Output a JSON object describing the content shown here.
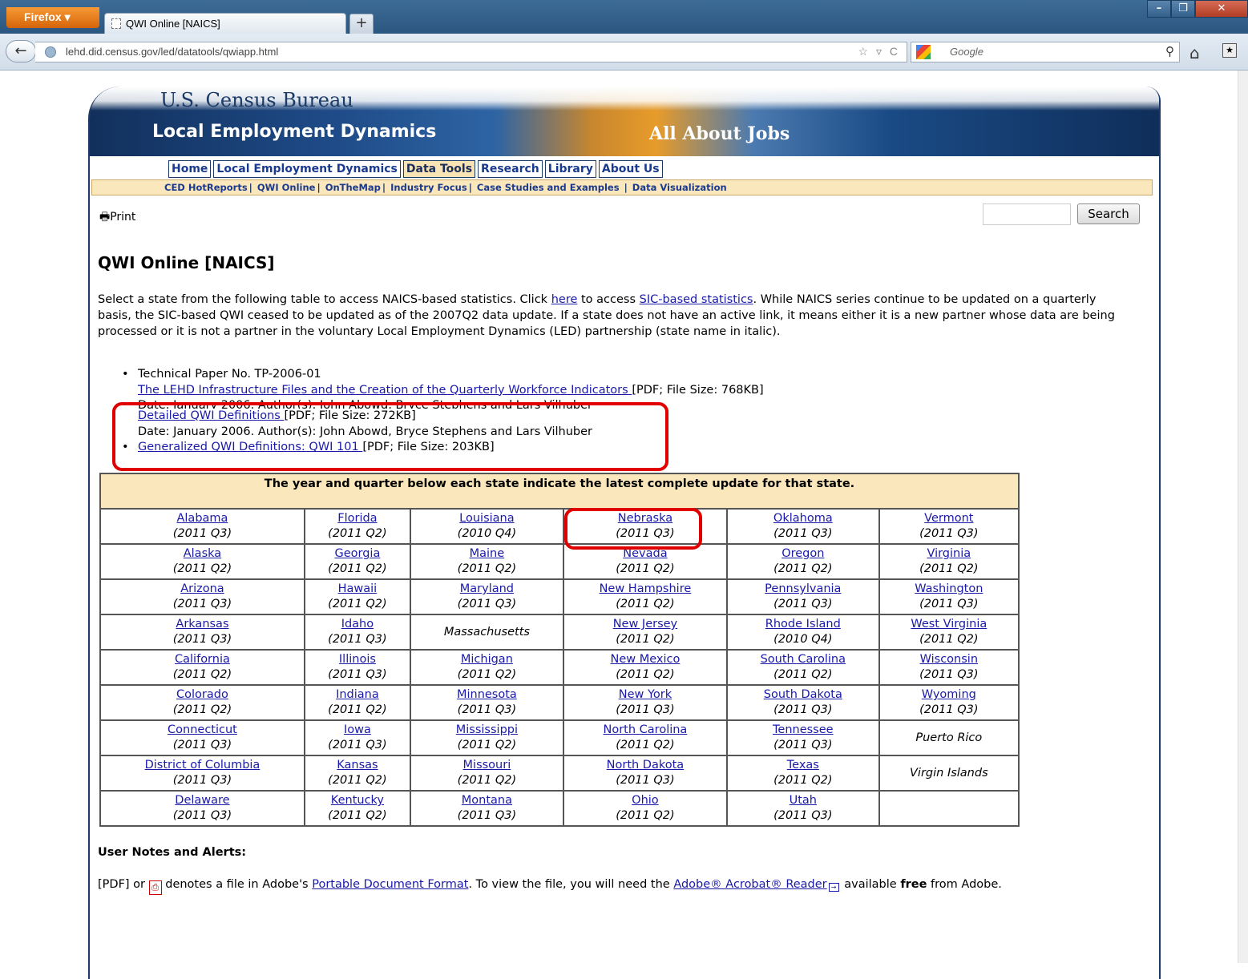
{
  "browser": {
    "menu_label": "Firefox ▾",
    "tab_title": "QWI Online [NAICS]",
    "new_tab": "+",
    "url": "lehd.did.census.gov/led/datatools/qwiapp.html",
    "search_engine_placeholder": "Google"
  },
  "banner": {
    "agency": "U.S. Census Bureau",
    "program": "Local Employment Dynamics",
    "tagline": "All About Jobs"
  },
  "nav": {
    "main": [
      "Home",
      "Local Employment Dynamics",
      "Data Tools",
      "Research",
      "Library",
      "About Us"
    ],
    "active": "Data Tools",
    "sub": [
      "CED HotReports",
      "QWI Online",
      "OnTheMap",
      "Industry Focus",
      "Case Studies and Examples",
      "Data Visualization"
    ]
  },
  "toolbar": {
    "print_label": "Print",
    "search_button": "Search"
  },
  "page": {
    "title": "QWI Online [NAICS]",
    "intro_1": "Select a state from the following table to access NAICS-based statistics. Click ",
    "intro_link_here": "here",
    "intro_2": " to access ",
    "intro_link_sic": "SIC-based statistics",
    "intro_3": ". While NAICS series continue to be updated on a quarterly basis, the SIC-based QWI ceased to be updated as of the 2007Q2 data update. If a state does not have an active link, it means either it is a new partner whose data are being processed or it is not a partner in the voluntary Local Employment Dynamics (LED) partnership (state name in italic)."
  },
  "docs": {
    "paper_no": "Technical Paper No. TP-2006-01",
    "paper_title": "The LEHD Infrastructure Files and the Creation of the Quarterly Workforce Indicators ",
    "paper_meta": "[PDF; File Size: 768KB]",
    "paper_date": "Date: January 2006. Author(s): John Abowd, Bryce Stephens and Lars Vilhuber",
    "detailed_title": "Detailed QWI Definitions ",
    "detailed_meta": "[PDF; File Size: 272KB]",
    "detailed_date": "Date: January 2006. Author(s): John Abowd, Bryce Stephens and Lars Vilhuber",
    "generalized_title": "Generalized QWI Definitions: QWI 101 ",
    "generalized_meta": "[PDF; File Size: 203KB]"
  },
  "table": {
    "header": "The year and quarter below each state indicate the latest complete update for that state.",
    "rows": [
      [
        [
          "Alabama",
          "(2011 Q3)"
        ],
        [
          "Florida",
          "(2011 Q2)"
        ],
        [
          "Louisiana",
          "(2010 Q4)"
        ],
        [
          "Nebraska",
          "(2011 Q3)"
        ],
        [
          "Oklahoma",
          "(2011 Q3)"
        ],
        [
          "Vermont",
          "(2011 Q3)"
        ]
      ],
      [
        [
          "Alaska",
          "(2011 Q2)"
        ],
        [
          "Georgia",
          "(2011 Q2)"
        ],
        [
          "Maine",
          "(2011 Q2)"
        ],
        [
          "Nevada",
          "(2011 Q2)"
        ],
        [
          "Oregon",
          "(2011 Q2)"
        ],
        [
          "Virginia",
          "(2011 Q2)"
        ]
      ],
      [
        [
          "Arizona",
          "(2011 Q3)"
        ],
        [
          "Hawaii",
          "(2011 Q2)"
        ],
        [
          "Maryland",
          "(2011 Q3)"
        ],
        [
          "New Hampshire",
          "(2011 Q2)"
        ],
        [
          "Pennsylvania",
          "(2011 Q3)"
        ],
        [
          "Washington",
          "(2011 Q3)"
        ]
      ],
      [
        [
          "Arkansas",
          "(2011 Q3)"
        ],
        [
          "Idaho",
          "(2011 Q3)"
        ],
        [
          "Massachusetts",
          ""
        ],
        [
          "New Jersey",
          "(2011 Q2)"
        ],
        [
          "Rhode Island",
          "(2010 Q4)"
        ],
        [
          "West Virginia",
          "(2011 Q2)"
        ]
      ],
      [
        [
          "California",
          "(2011 Q2)"
        ],
        [
          "Illinois",
          "(2011 Q3)"
        ],
        [
          "Michigan",
          "(2011 Q2)"
        ],
        [
          "New Mexico",
          "(2011 Q2)"
        ],
        [
          "South Carolina",
          "(2011 Q2)"
        ],
        [
          "Wisconsin",
          "(2011 Q3)"
        ]
      ],
      [
        [
          "Colorado",
          "(2011 Q2)"
        ],
        [
          "Indiana",
          "(2011 Q2)"
        ],
        [
          "Minnesota",
          "(2011 Q3)"
        ],
        [
          "New York",
          "(2011 Q3)"
        ],
        [
          "South Dakota",
          "(2011 Q3)"
        ],
        [
          "Wyoming",
          "(2011 Q3)"
        ]
      ],
      [
        [
          "Connecticut",
          "(2011 Q3)"
        ],
        [
          "Iowa",
          "(2011 Q3)"
        ],
        [
          "Mississippi",
          "(2011 Q2)"
        ],
        [
          "North Carolina",
          "(2011 Q2)"
        ],
        [
          "Tennessee",
          "(2011 Q3)"
        ],
        [
          "Puerto Rico",
          ""
        ]
      ],
      [
        [
          "District of Columbia",
          "(2011 Q3)"
        ],
        [
          "Kansas",
          "(2011 Q2)"
        ],
        [
          "Missouri",
          "(2011 Q2)"
        ],
        [
          "North Dakota",
          "(2011 Q3)"
        ],
        [
          "Texas",
          "(2011 Q2)"
        ],
        [
          "Virgin Islands",
          ""
        ]
      ],
      [
        [
          "Delaware",
          "(2011 Q3)"
        ],
        [
          "Kentucky",
          "(2011 Q2)"
        ],
        [
          "Montana",
          "(2011 Q3)"
        ],
        [
          "Ohio",
          "(2011 Q2)"
        ],
        [
          "Utah",
          "(2011 Q3)"
        ],
        [
          "",
          ""
        ]
      ]
    ]
  },
  "notes": {
    "heading": "User Notes and Alerts:",
    "pdf_prefix": "[PDF] or ",
    "pdf_mid": " denotes a file in Adobe's ",
    "pdf_link": "Portable Document Format",
    "pdf_mid2": ". To view the file, you will need the ",
    "reader_link": "Adobe® Acrobat® Reader",
    "pdf_mid3": " available ",
    "free": "free",
    "pdf_end": " from Adobe."
  },
  "annotations": {
    "highlight_color": "#e00000"
  }
}
